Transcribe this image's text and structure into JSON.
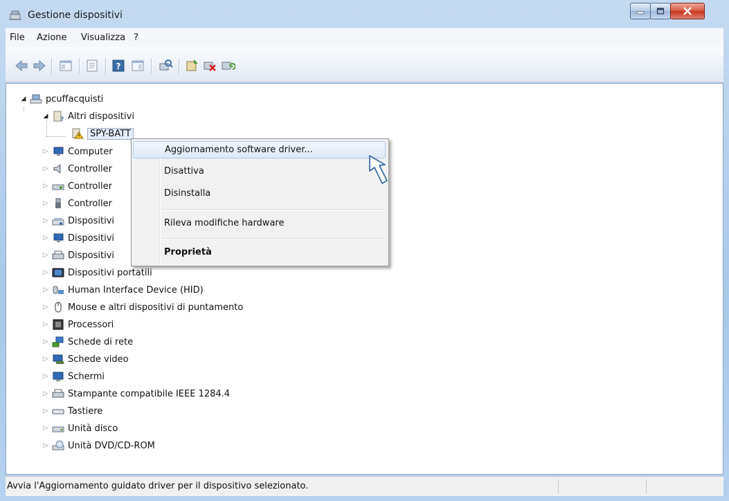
{
  "window": {
    "title": "Gestione dispositivi"
  },
  "menu": [
    "File",
    "Azione",
    "Visualizza",
    "?"
  ],
  "toolbar": {
    "icons": [
      "back-arrow-icon",
      "forward-arrow-icon",
      "show-hide-console-tree-icon",
      "properties-icon",
      "help-icon",
      "action-pane-icon",
      "scan-hardware-icon",
      "update-driver-icon",
      "disable-device-icon",
      "uninstall-device-icon"
    ]
  },
  "tree": {
    "root": "pcuffacquisti",
    "expanded_category": "Altri dispositivi",
    "selected_device": "SPY-BATT",
    "categories": [
      "Computer",
      "Controller",
      "Controller",
      "Controller",
      "Dispositivi",
      "Dispositivi",
      "Dispositivi",
      "Dispositivi portatili",
      "Human Interface Device (HID)",
      "Mouse e altri dispositivi di puntamento",
      "Processori",
      "Schede di rete",
      "Schede video",
      "Schermi",
      "Stampante compatibile IEEE 1284.4",
      "Tastiere",
      "Unità disco",
      "Unità DVD/CD-ROM"
    ]
  },
  "context_menu": {
    "items": [
      {
        "label": "Aggiornamento software driver...",
        "highlighted": true
      },
      {
        "label": "Disattiva"
      },
      {
        "label": "Disinstalla"
      },
      {
        "label": "Rileva modifiche hardware"
      },
      {
        "label": "Proprietà",
        "bold": true
      }
    ]
  },
  "status": {
    "text": "Avvia l'Aggiornamento guidato driver per il dispositivo selezionato."
  },
  "colors": {
    "accent": "#3a6ea5",
    "highlight": "#dde9f8",
    "close": "#c5361e"
  }
}
